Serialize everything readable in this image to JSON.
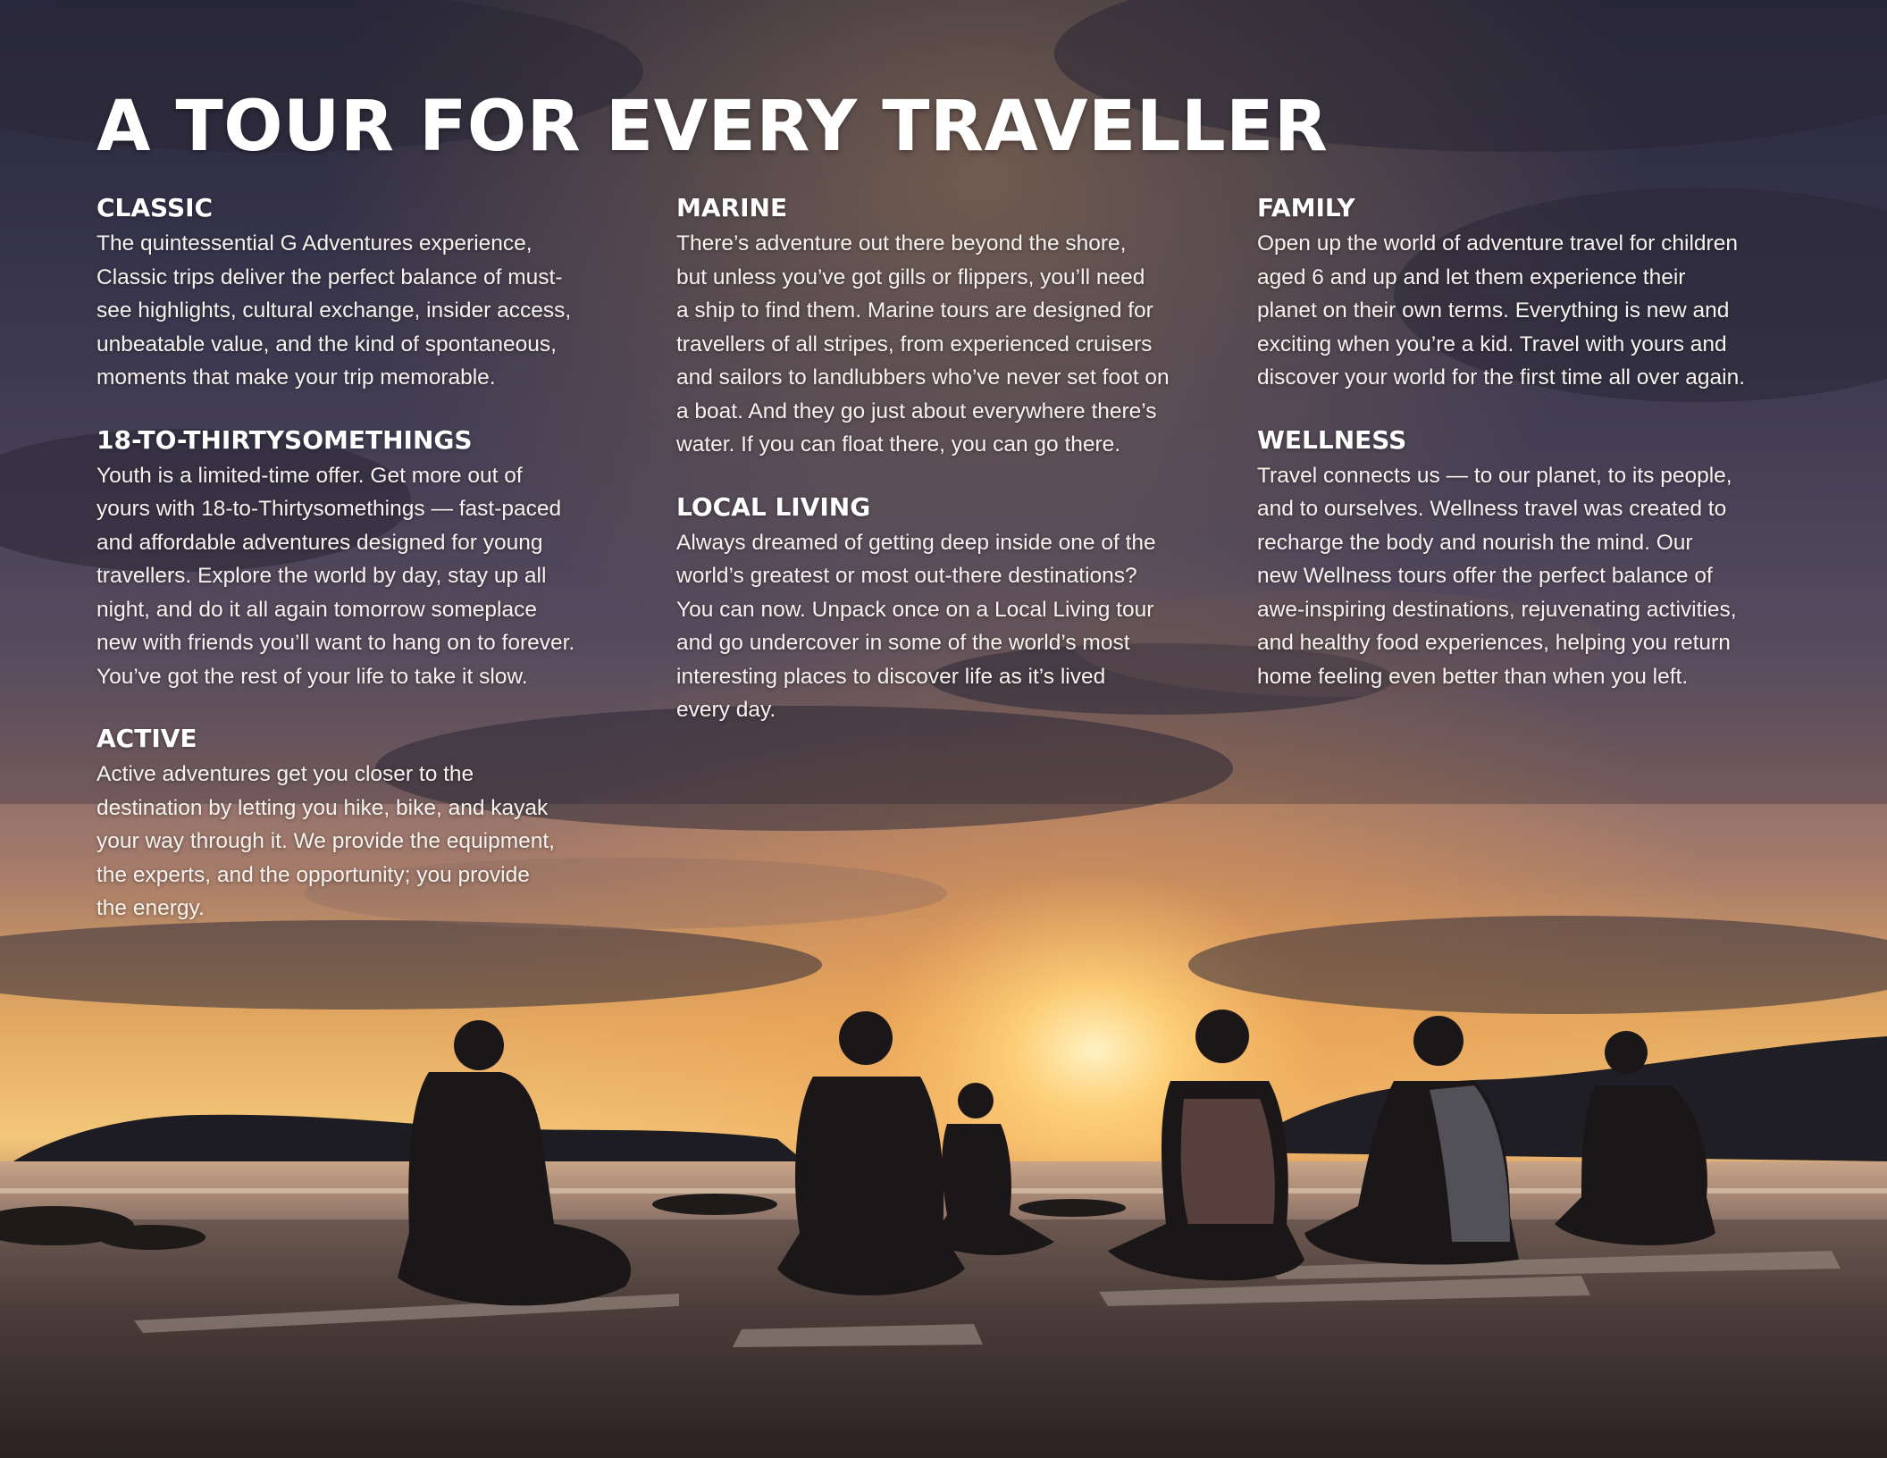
{
  "title": "A TOUR FOR EVERY TRAVELLER",
  "columns": [
    {
      "sections": [
        {
          "heading": "CLASSIC",
          "lines": [
            "The quintessential G Adventures experience,",
            "Classic trips deliver the perfect balance of must-",
            "see highlights, cultural exchange, insider access,",
            "unbeatable value, and the kind of spontaneous,",
            "moments that make your trip memorable."
          ]
        },
        {
          "heading": "18-TO-THIRTYSOMETHINGS",
          "lines": [
            "Youth is a limited-time offer. Get more out of",
            "yours with 18-to-Thirtysomethings — fast-paced",
            "and affordable adventures designed for young",
            "travellers. Explore the world by day, stay up all",
            "night, and do it all again tomorrow someplace",
            "new with friends you’ll want to hang on to forever.",
            "You’ve got the rest of your life to take it slow."
          ]
        },
        {
          "heading": "ACTIVE",
          "lines": [
            "Active adventures get you closer to the",
            "destination by letting you hike, bike, and kayak",
            "your way through it. We provide the equipment,",
            "the experts, and the opportunity; you provide",
            "the energy."
          ]
        }
      ]
    },
    {
      "sections": [
        {
          "heading": "MARINE",
          "lines": [
            "There’s adventure out there beyond the shore,",
            "but unless you’ve got gills or flippers, you’ll need",
            "a ship to find them. Marine tours are designed for",
            "travellers of all stripes, from experienced cruisers",
            "and sailors to landlubbers who’ve never set foot on",
            "a boat. And they go just about everywhere there’s",
            "water. If you can float there, you can go there."
          ]
        },
        {
          "heading": "LOCAL LIVING",
          "lines": [
            "Always dreamed of getting deep inside one of the",
            "world’s greatest or most out-there destinations?",
            "You can now. Unpack once on a Local Living tour",
            "and go undercover in some of the world’s most",
            "interesting places to discover life as it’s lived",
            "every day."
          ]
        }
      ]
    },
    {
      "sections": [
        {
          "heading": "FAMILY",
          "lines": [
            "Open up the world of adventure travel for children",
            "aged 6 and up and let them experience their",
            "planet on their own terms. Everything is new and",
            "exciting when you’re a kid. Travel with yours and",
            "discover your world for the first time all over again."
          ]
        },
        {
          "heading": "WELLNESS",
          "lines": [
            "Travel connects us — to our planet, to its people,",
            "and to ourselves. Wellness travel was created to",
            "recharge the body and nourish the mind. Our",
            "new Wellness tours offer the perfect balance of",
            "awe-inspiring destinations, rejuvenating activities,",
            "and healthy food experiences, helping you return",
            "home feeling even better than when you left."
          ]
        }
      ]
    }
  ]
}
